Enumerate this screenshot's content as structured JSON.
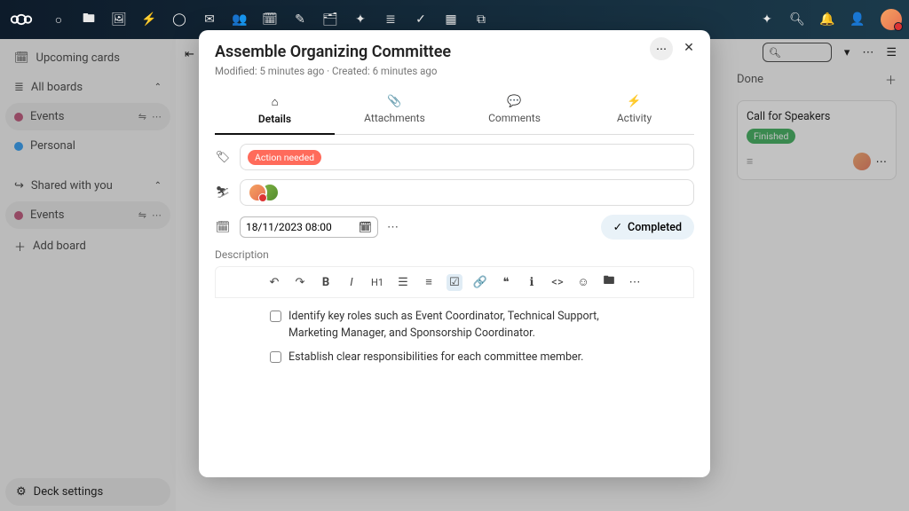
{
  "topbar": {
    "apps": [
      "dashboard",
      "files",
      "photos",
      "activity",
      "talk",
      "mail",
      "contacts",
      "calendar",
      "notes",
      "deck",
      "tasks",
      "checklist",
      "forms",
      "more"
    ]
  },
  "sidebar": {
    "upcoming": "Upcoming cards",
    "all_boards": "All boards",
    "events1": "Events",
    "personal": "Personal",
    "shared": "Shared with you",
    "events2": "Events",
    "add_board": "Add board",
    "settings": "Deck settings"
  },
  "board": {
    "done_label": "Done",
    "card1_title": "Call for Speakers",
    "card1_badge": "Finished"
  },
  "modal": {
    "title": "Assemble Organizing Committee",
    "subtitle": "Modified: 5 minutes ago · Created: 6 minutes ago",
    "tabs": {
      "details": "Details",
      "attachments": "Attachments",
      "comments": "Comments",
      "activity": "Activity"
    },
    "tag": "Action needed",
    "date": "18/11/2023 08:00",
    "completed": "Completed",
    "description_label": "Description",
    "checks": [
      "Identify key roles such as Event Coordinator, Technical Support, Marketing Manager, and Sponsorship Coordinator.",
      "Establish clear responsibilities for each committee member."
    ]
  }
}
